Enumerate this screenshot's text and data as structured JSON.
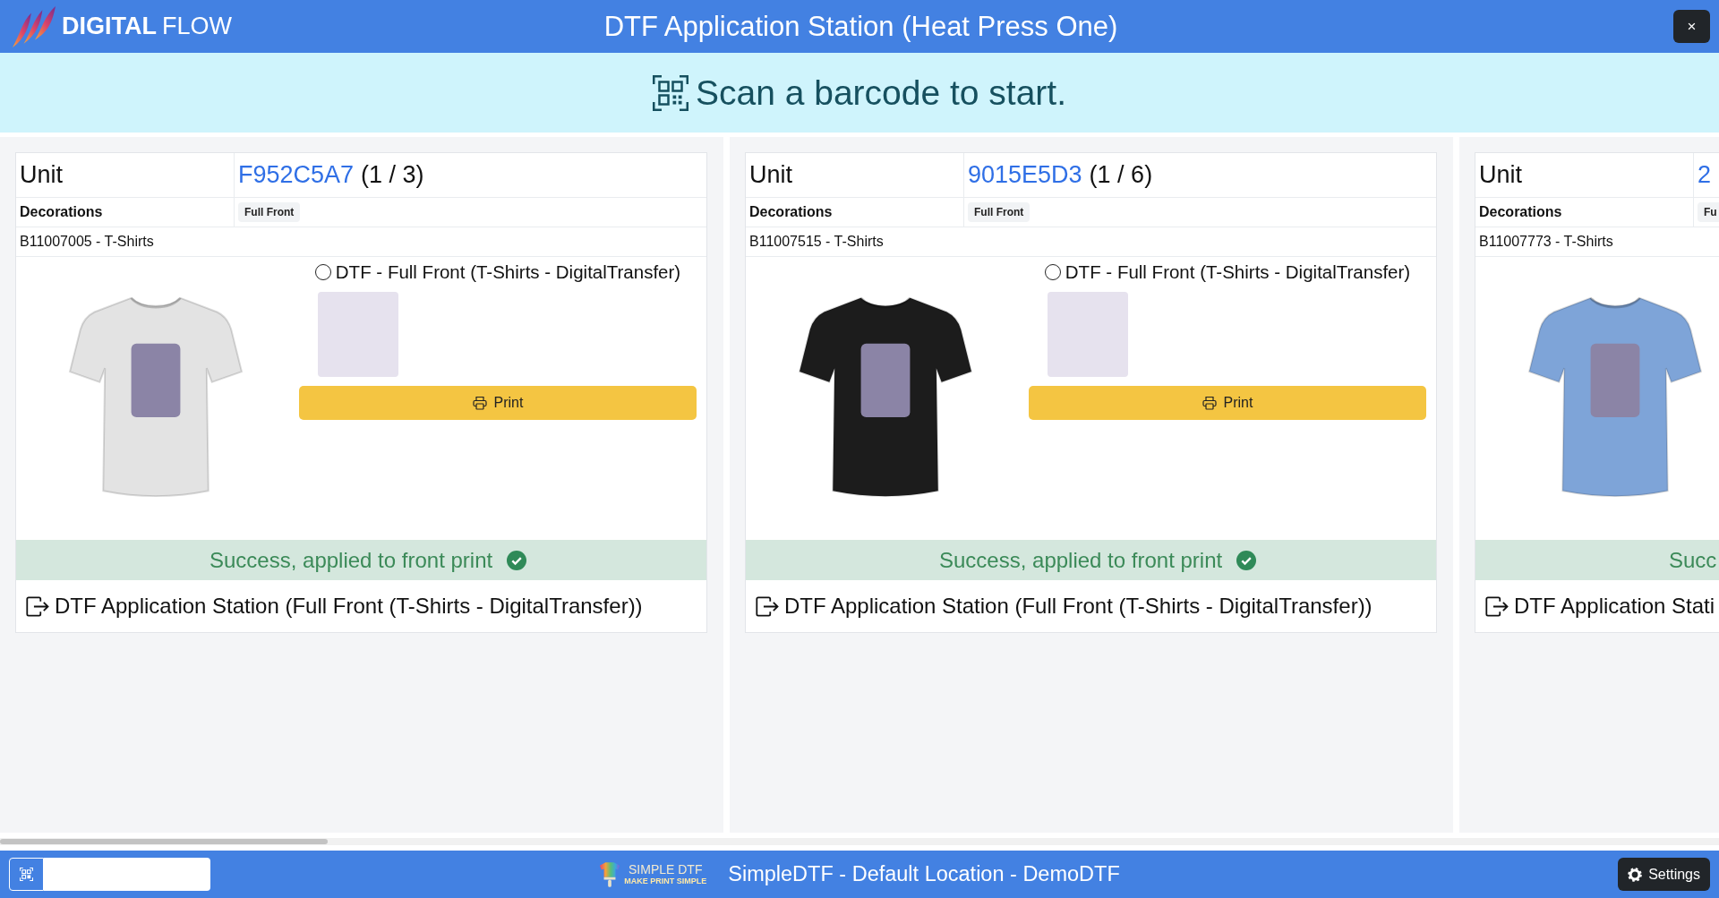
{
  "header": {
    "logo_words": [
      "DIGITAL",
      "FLOW"
    ],
    "title": "DTF Application Station (Heat Press One)",
    "close": "×"
  },
  "banner": {
    "message": "Scan a barcode to start."
  },
  "units": [
    {
      "label": "Unit",
      "code": "F952C5A7",
      "count": "(1 / 3)",
      "decorations_label": "Decorations",
      "decorations": [
        "Full Front"
      ],
      "item": "B11007005 - T-Shirts",
      "shirt": {
        "color": "#e3e3e3"
      },
      "options": [
        {
          "label": "DTF - Full Front (T-Shirts - DigitalTransfer)",
          "selected": false
        }
      ],
      "print_button": "Print",
      "status": "Success, applied to front print",
      "station": "DTF Application Station (Full Front (T-Shirts - DigitalTransfer))"
    },
    {
      "label": "Unit",
      "code": "9015E5D3",
      "count": "(1 / 6)",
      "decorations_label": "Decorations",
      "decorations": [
        "Full Front"
      ],
      "item": "B11007515 - T-Shirts",
      "shirt": {
        "color": "#1c1c1c"
      },
      "options": [
        {
          "label": "DTF - Full Front (T-Shirts - DigitalTransfer)",
          "selected": false
        }
      ],
      "print_button": "Print",
      "status": "Success, applied to front print",
      "station": "DTF Application Station (Full Front (T-Shirts - DigitalTransfer))"
    },
    {
      "label": "Unit",
      "code": "2",
      "decorations_label": "Decorations",
      "decorations": [
        "Fu"
      ],
      "item": "B11007773 - T-Shirts",
      "shirt": {
        "color": "#7ea4d8"
      },
      "status": "Succ",
      "station": "DTF Application Stati"
    }
  ],
  "footer": {
    "logo_text": "SIMPLE DTF",
    "logo_tagline": "MAKE PRINT SIMPLE",
    "location": "SimpleDTF - Default Location - DemoDTF",
    "settings": "Settings"
  }
}
